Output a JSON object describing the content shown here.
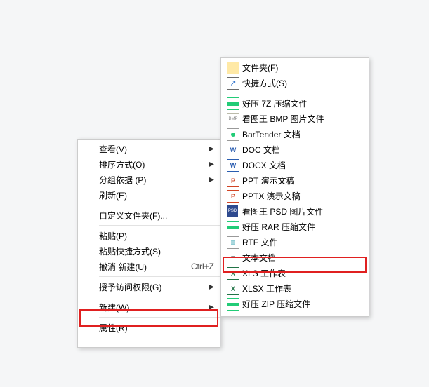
{
  "menu1": {
    "items": [
      {
        "label": "查看(V)",
        "arrow": true
      },
      {
        "label": "排序方式(O)",
        "arrow": true
      },
      {
        "label": "分组依据 (P)",
        "arrow": true
      },
      {
        "label": "刷新(E)"
      },
      {
        "sep": true
      },
      {
        "label": "自定义文件夹(F)..."
      },
      {
        "sep": true
      },
      {
        "label": "粘贴(P)"
      },
      {
        "label": "粘贴快捷方式(S)"
      },
      {
        "label": "撤消 新建(U)",
        "shortcut": "Ctrl+Z"
      },
      {
        "sep": true
      },
      {
        "label": "授予访问权限(G)",
        "arrow": true
      },
      {
        "sep": true
      },
      {
        "label": "新建(W)",
        "arrow": true,
        "key": "new"
      },
      {
        "sep": true
      },
      {
        "label": "属性(R)"
      }
    ]
  },
  "menu2": {
    "items": [
      {
        "label": "文件夹(F)",
        "icon": "folder"
      },
      {
        "label": "快捷方式(S)",
        "icon": "shortcut"
      },
      {
        "sep": true
      },
      {
        "label": "好压 7Z 压缩文件",
        "icon": "archive"
      },
      {
        "label": "看图王 BMP 图片文件",
        "icon": "bmp"
      },
      {
        "label": "BarTender 文档",
        "icon": "btw"
      },
      {
        "label": "DOC 文档",
        "icon": "doc"
      },
      {
        "label": "DOCX 文档",
        "icon": "docx"
      },
      {
        "label": "PPT 演示文稿",
        "icon": "ppt"
      },
      {
        "label": "PPTX 演示文稿",
        "icon": "pptx"
      },
      {
        "label": "看图王 PSD 图片文件",
        "icon": "psd"
      },
      {
        "label": "好压 RAR 压缩文件",
        "icon": "archive"
      },
      {
        "label": "RTF 文件",
        "icon": "rtf"
      },
      {
        "label": "文本文档",
        "icon": "txt",
        "key": "text-doc"
      },
      {
        "label": "XLS 工作表",
        "icon": "xls"
      },
      {
        "label": "XLSX 工作表",
        "icon": "xlsx"
      },
      {
        "label": "好压 ZIP 压缩文件",
        "icon": "archive"
      }
    ]
  }
}
